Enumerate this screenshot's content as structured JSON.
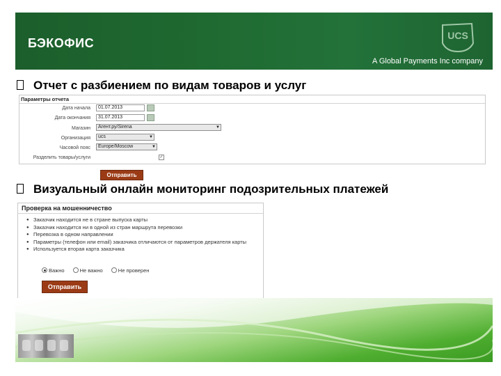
{
  "header": {
    "title": "БЭКОФИС",
    "subtitle": "A Global Payments Inc company",
    "logo_text": "UCS",
    "colors": {
      "header_bg": "#1f6a31",
      "button_bg": "#9b3b16"
    }
  },
  "section1": {
    "heading": "Отчет с разбиением по видам товаров и услуг",
    "form": {
      "title": "Параметры отчета",
      "fields": [
        {
          "label": "Дата начала",
          "value": "01.07.2013"
        },
        {
          "label": "Дата окончания",
          "value": "31.07.2013"
        },
        {
          "label": "Магазин",
          "value": "Агент.ру/Sirena"
        },
        {
          "label": "Организация",
          "value": "ucs"
        },
        {
          "label": "Часовой пояс",
          "value": "Europe/Moscow"
        },
        {
          "label": "Разделить товары/услуги",
          "value": ""
        }
      ],
      "submit_label": "Отправить"
    }
  },
  "section2": {
    "heading": "Визуальный онлайн мониторинг подозрительных платежей",
    "form": {
      "title": "Проверка на мошенничество",
      "items": [
        "Заказчик находится не в стране выпуска карты",
        "Заказчик находится ни в одной из стран маршрута перевозки",
        "Перевозка в одном направлении",
        "Параметры (телефон или email) заказчика отличаются от параметров держателя карты",
        "Используется вторая карта заказчика"
      ],
      "radios": [
        "Важно",
        "Не важно",
        "Не проверен"
      ],
      "selected_radio": "Важно",
      "submit_label": "Отправить"
    }
  }
}
